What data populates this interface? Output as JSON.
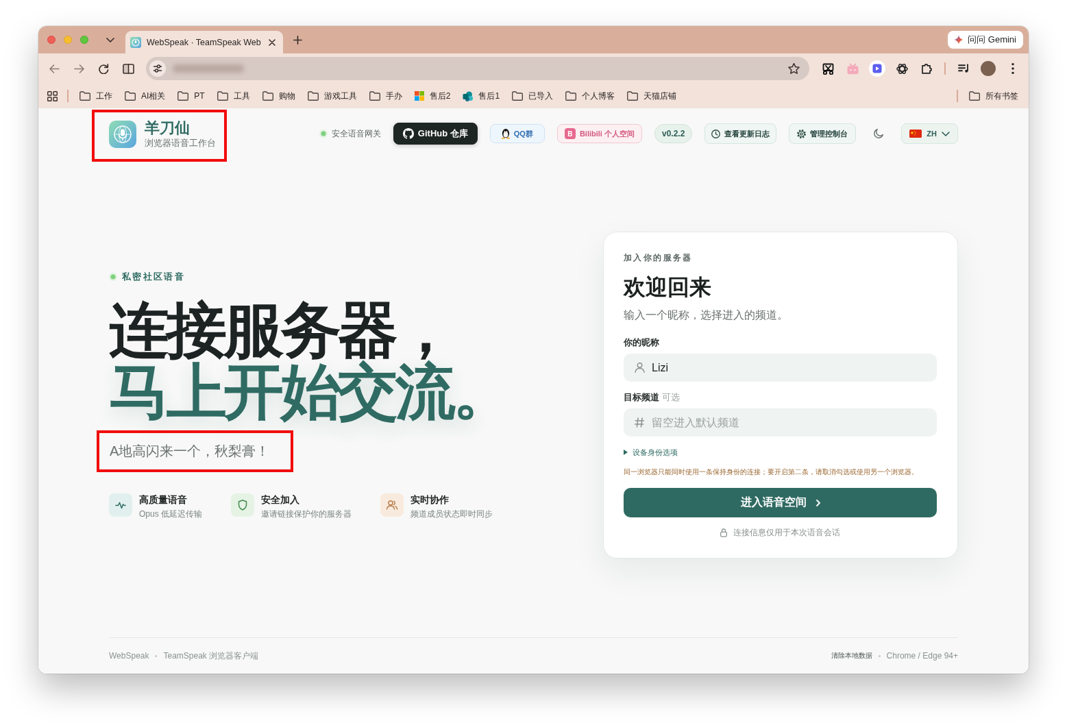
{
  "browser": {
    "tabs": [
      {
        "title": "WebSpeak · TeamSpeak Web",
        "selected": true
      }
    ],
    "gemini": "问问 Gemini",
    "bookmarks": [
      {
        "label": "工作",
        "kind": "folder"
      },
      {
        "label": "AI相关",
        "kind": "folder"
      },
      {
        "label": "PT",
        "kind": "folder"
      },
      {
        "label": "工具",
        "kind": "folder"
      },
      {
        "label": "购物",
        "kind": "folder"
      },
      {
        "label": "游戏工具",
        "kind": "folder"
      },
      {
        "label": "手办",
        "kind": "folder"
      },
      {
        "label": "售后2",
        "kind": "tiles"
      },
      {
        "label": "售后1",
        "kind": "cloud"
      },
      {
        "label": "已导入",
        "kind": "folder"
      },
      {
        "label": "个人博客",
        "kind": "folder"
      },
      {
        "label": "天猫店铺",
        "kind": "folder"
      }
    ],
    "all_bookmarks": "所有书签"
  },
  "header": {
    "brand": {
      "name": "羊刀仙",
      "subtitle": "浏览器语音工作台",
      "highlighted": true
    },
    "status": {
      "label": "安全语音网关",
      "online": true
    },
    "nav": [
      {
        "label": "GitHub 仓库",
        "kind": "github"
      },
      {
        "label": "QQ群",
        "kind": "qq"
      },
      {
        "label": "Bilibili 个人空间",
        "kind": "bilibili",
        "badge": "B"
      },
      {
        "label": "v0.2.2",
        "kind": "version"
      },
      {
        "label": "查看更新日志",
        "kind": "changelog"
      },
      {
        "label": "管理控制台",
        "kind": "admin"
      }
    ],
    "language": {
      "code": "ZH"
    }
  },
  "hero": {
    "eyebrow": "私密社区语音",
    "headline": [
      {
        "text": "连接服务器，",
        "accent": false
      },
      {
        "text": "马上开始交流。",
        "accent": true
      }
    ],
    "tagline": {
      "text": "A地高闪来一个，秋梨膏！",
      "highlighted": true
    },
    "features": [
      {
        "title": "高质量语音",
        "subtitle": "Opus 低延迟传输",
        "kind": "voice"
      },
      {
        "title": "安全加入",
        "subtitle": "邀请链接保护你的服务器",
        "kind": "secure"
      },
      {
        "title": "实时协作",
        "subtitle": "频道成员状态即时同步",
        "kind": "team"
      }
    ]
  },
  "join_card": {
    "eyebrow": "加入你的服务器",
    "title": "欢迎回来",
    "subtitle": "输入一个昵称，选择进入的频道。",
    "fields": [
      {
        "label": "你的昵称",
        "kind": "user",
        "value": "Lizi"
      },
      {
        "label": "目标频道",
        "hint": "可选",
        "kind": "channel",
        "placeholder": "留空进入默认频道"
      }
    ],
    "device_options": {
      "label": "设备身份选项",
      "expanded": false
    },
    "warning": "同一浏览器只能同时使用一条保持身份的连接；要开启第二条，请取消勾选或使用另一个浏览器。",
    "submit": "进入语音空间",
    "note": "连接信息仅用于本次语音会话"
  },
  "footer": {
    "left": [
      "WebSpeak",
      "TeamSpeak 浏览器客户端"
    ],
    "clear_data": "清除本地数据",
    "browsers": "Chrome / Edge 94+"
  }
}
